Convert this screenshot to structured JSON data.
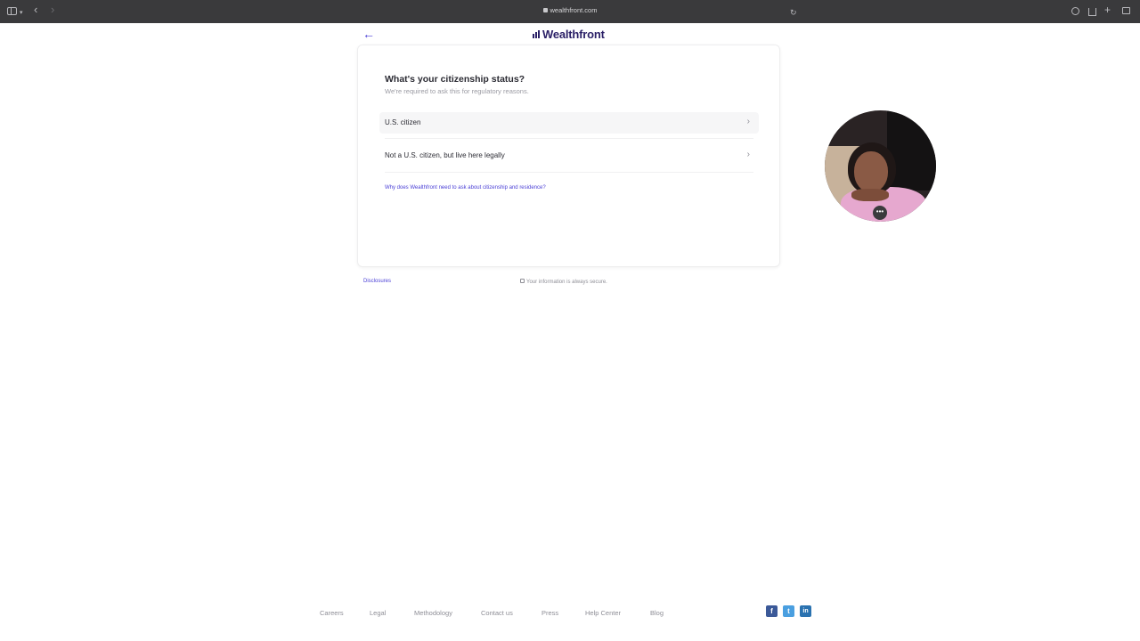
{
  "browser": {
    "url": "wealthfront.com"
  },
  "header": {
    "back_icon": "arrow-left-icon",
    "logo_text": "Wealthfront"
  },
  "question": {
    "title": "What's your citizenship status?",
    "subtitle": "We're required to ask this for regulatory reasons.",
    "options": [
      {
        "label": "U.S. citizen"
      },
      {
        "label": "Not a U.S. citizen, but live here legally"
      }
    ],
    "help_link": "Why does Wealthfront need to ask about citizenship and residence?"
  },
  "below_card": {
    "disclosures": "Disclosures",
    "secure_note": "Your information is always secure."
  },
  "footer": {
    "links": [
      "Careers",
      "Legal",
      "Methodology",
      "Contact us",
      "Press",
      "Help Center",
      "Blog"
    ],
    "social": [
      "f",
      "t",
      "in"
    ]
  },
  "colors": {
    "accent": "#4a3fd6",
    "logo": "#2a1f66",
    "chrome": "#3a3a3c",
    "facebook": "#3b5998",
    "twitter": "#4a9fe0",
    "linkedin": "#2a72b0"
  }
}
